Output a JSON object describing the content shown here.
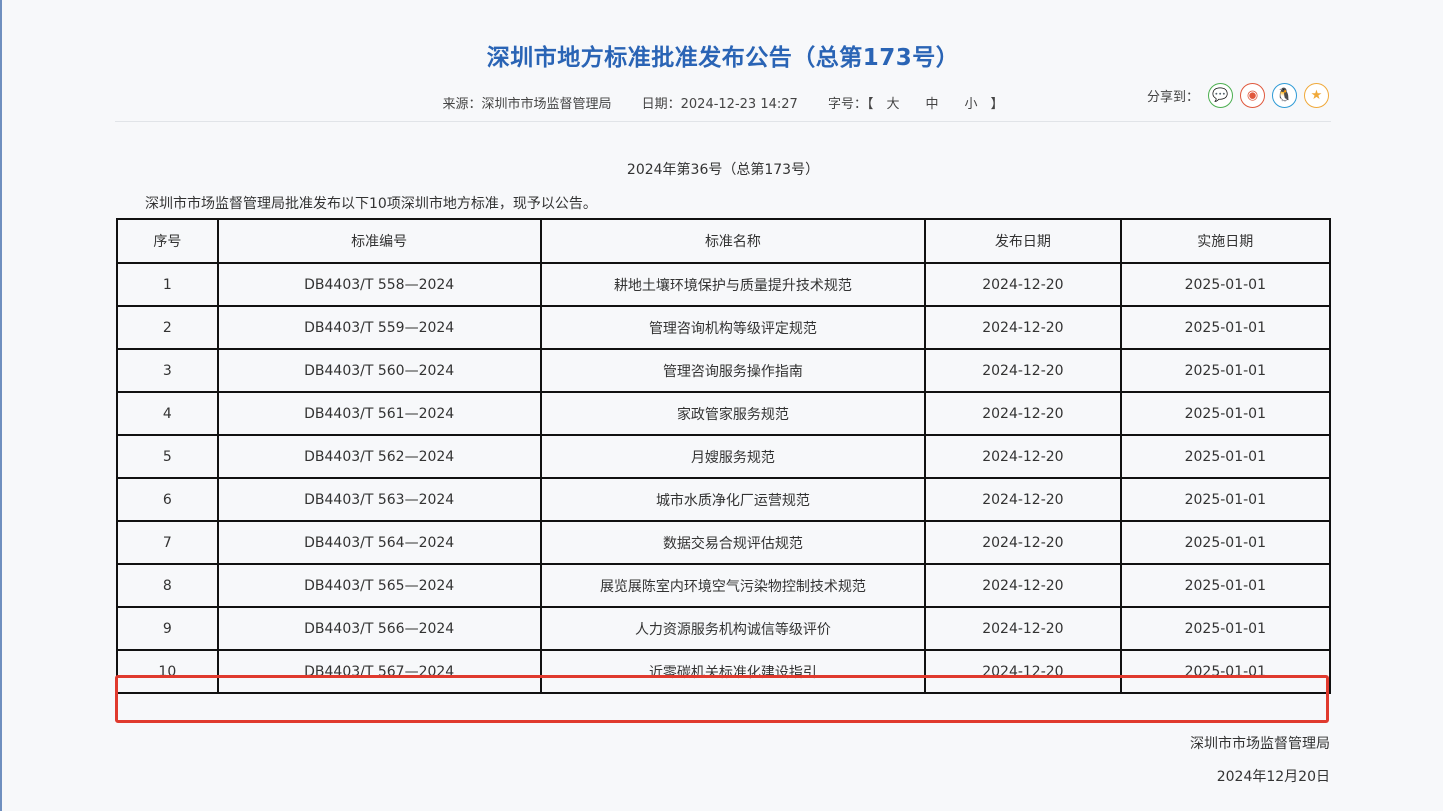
{
  "title": "深圳市地方标准批准发布公告（总第173号）",
  "meta": {
    "source": "来源：深圳市市场监督管理局",
    "date": "日期：2024-12-23 14:27",
    "font_label": "字号：【",
    "font_large": "大",
    "font_medium": "中",
    "font_small": "小",
    "font_close": "】"
  },
  "share": {
    "label": "分享到：",
    "icons": [
      {
        "name": "wechat",
        "color": "#4caf50",
        "glyph": "💬"
      },
      {
        "name": "weibo",
        "color": "#e0583c",
        "glyph": "◉"
      },
      {
        "name": "qq",
        "color": "#2f9bd6",
        "glyph": "🐧"
      },
      {
        "name": "favorite",
        "color": "#f0a93a",
        "glyph": "★"
      }
    ]
  },
  "issue": "2024年第36号（总第173号）",
  "intro": "深圳市市场监督管理局批准发布以下10项深圳市地方标准，现予以公告。",
  "table": {
    "headers": [
      "序号",
      "标准编号",
      "标准名称",
      "发布日期",
      "实施日期"
    ],
    "rows": [
      [
        "1",
        "DB4403/T 558—2024",
        "耕地土壤环境保护与质量提升技术规范",
        "2024-12-20",
        "2025-01-01"
      ],
      [
        "2",
        "DB4403/T 559—2024",
        "管理咨询机构等级评定规范",
        "2024-12-20",
        "2025-01-01"
      ],
      [
        "3",
        "DB4403/T 560—2024",
        "管理咨询服务操作指南",
        "2024-12-20",
        "2025-01-01"
      ],
      [
        "4",
        "DB4403/T 561—2024",
        "家政管家服务规范",
        "2024-12-20",
        "2025-01-01"
      ],
      [
        "5",
        "DB4403/T 562—2024",
        "月嫂服务规范",
        "2024-12-20",
        "2025-01-01"
      ],
      [
        "6",
        "DB4403/T 563—2024",
        "城市水质净化厂运营规范",
        "2024-12-20",
        "2025-01-01"
      ],
      [
        "7",
        "DB4403/T 564—2024",
        "数据交易合规评估规范",
        "2024-12-20",
        "2025-01-01"
      ],
      [
        "8",
        "DB4403/T 565—2024",
        "展览展陈室内环境空气污染物控制技术规范",
        "2024-12-20",
        "2025-01-01"
      ],
      [
        "9",
        "DB4403/T 566—2024",
        "人力资源服务机构诚信等级评价",
        "2024-12-20",
        "2025-01-01"
      ],
      [
        "10",
        "DB4403/T 567—2024",
        "近零碳机关标准化建设指引",
        "2024-12-20",
        "2025-01-01"
      ]
    ]
  },
  "signature": {
    "org": "深圳市市场监督管理局",
    "date": "2024年12月20日"
  },
  "colors": {
    "title": "#2a64b5",
    "highlight": "#e03a2e"
  }
}
